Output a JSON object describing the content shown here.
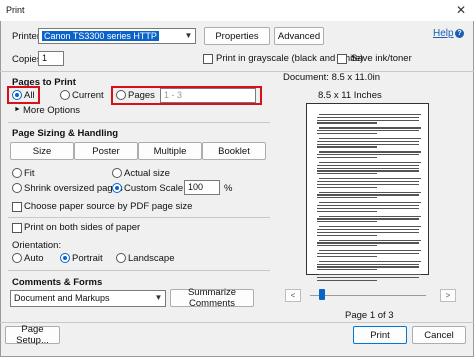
{
  "window": {
    "title": "Print",
    "close_glyph": "✕"
  },
  "printer": {
    "label": "Printer:",
    "selected": "Canon TS3300 series HTTP",
    "properties_label": "Properties",
    "advanced_label": "Advanced",
    "help_label": "Help"
  },
  "copies": {
    "label": "Copies:",
    "value": "1",
    "grayscale_label": "Print in grayscale (black and white)",
    "grayscale_checked": false,
    "save_ink_label": "Save ink/toner",
    "save_ink_checked": false
  },
  "pages_to_print": {
    "heading": "Pages to Print",
    "all_label": "All",
    "current_label": "Current",
    "pages_label": "Pages",
    "pages_value": "1 - 3",
    "selected": "All",
    "more_options_label": "More Options"
  },
  "sizing": {
    "heading": "Page Sizing & Handling",
    "size_label": "Size",
    "poster_label": "Poster",
    "multiple_label": "Multiple",
    "booklet_label": "Booklet",
    "fit_label": "Fit",
    "actual_size_label": "Actual size",
    "shrink_label": "Shrink oversized pages",
    "custom_scale_label": "Custom Scale:",
    "scale_value": "100",
    "percent_label": "%",
    "selected": "Custom Scale",
    "paper_source_label": "Choose paper source by PDF page size",
    "both_sides_label": "Print on both sides of paper"
  },
  "orientation": {
    "heading": "Orientation:",
    "auto_label": "Auto",
    "portrait_label": "Portrait",
    "landscape_label": "Landscape",
    "selected": "Portrait"
  },
  "comments": {
    "heading": "Comments & Forms",
    "selected": "Document and Markups",
    "summarize_label": "Summarize Comments"
  },
  "preview": {
    "document_size": "Document: 8.5 x 11.0in",
    "paper_size": "8.5 x 11 Inches",
    "page_indicator": "Page 1 of 3",
    "prev_glyph": "<",
    "next_glyph": ">",
    "slider_position": 0.08
  },
  "footer": {
    "page_setup_label": "Page Setup...",
    "print_label": "Print",
    "cancel_label": "Cancel"
  },
  "colors": {
    "accent": "#0a63c9",
    "highlight_box": "#d8101a"
  }
}
